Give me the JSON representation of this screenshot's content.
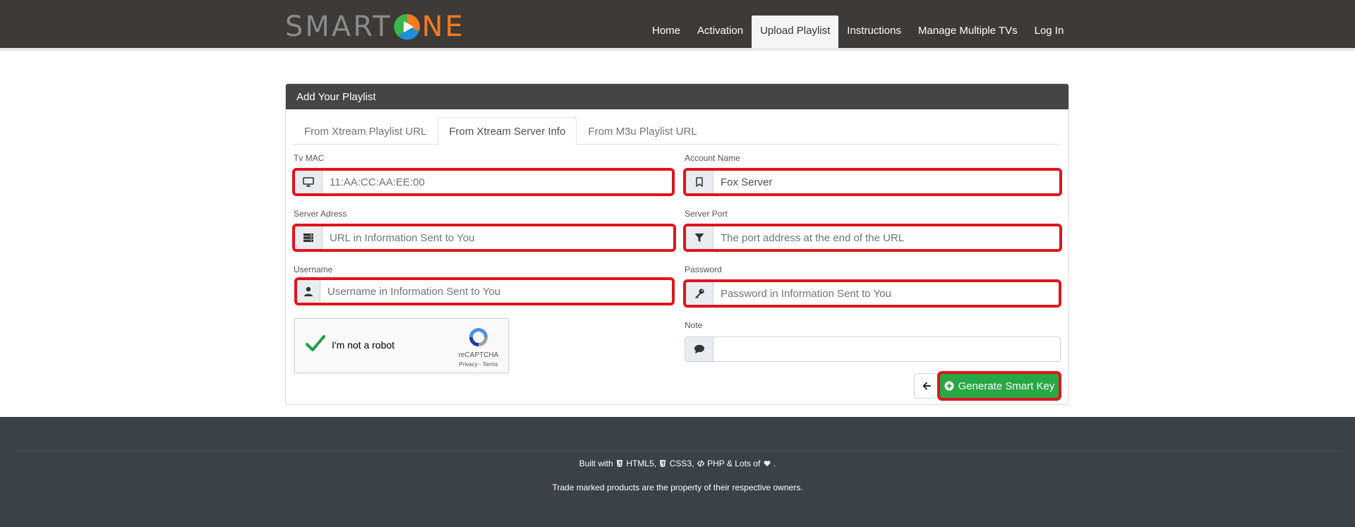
{
  "brand": {
    "part1": "SMART",
    "part2": "NE"
  },
  "nav": {
    "items": [
      {
        "label": "Home"
      },
      {
        "label": "Activation"
      },
      {
        "label": "Upload Playlist"
      },
      {
        "label": "Instructions"
      },
      {
        "label": "Manage Multiple TVs"
      },
      {
        "label": "Log In"
      }
    ],
    "active_index": 2
  },
  "card": {
    "title": "Add Your Playlist",
    "tabs": [
      {
        "label": "From Xtream Playlist URL"
      },
      {
        "label": "From Xtream Server Info"
      },
      {
        "label": "From M3u Playlist URL"
      }
    ],
    "active_tab": 1
  },
  "form": {
    "tv_mac": {
      "label": "Tv MAC",
      "value": "",
      "placeholder": "11:AA:CC:AA:EE:00",
      "icon": "tv-icon"
    },
    "account_name": {
      "label": "Account Name",
      "value": "Fox Server",
      "placeholder": "",
      "icon": "bookmark-icon"
    },
    "server_address": {
      "label": "Server Adress",
      "value": "",
      "placeholder": "URL in Information Sent to You",
      "icon": "server-icon"
    },
    "server_port": {
      "label": "Server Port",
      "value": "",
      "placeholder": "The port address at the end of the URL",
      "icon": "filter-icon"
    },
    "username": {
      "label": "Username",
      "value": "",
      "placeholder": "Username in Information Sent to You",
      "icon": "user-icon"
    },
    "password": {
      "label": "Password",
      "value": "",
      "placeholder": "Password in Information Sent to You",
      "icon": "key-icon"
    },
    "note": {
      "label": "Note",
      "value": "",
      "placeholder": "",
      "icon": "comment-icon"
    }
  },
  "recaptcha": {
    "label": "I'm not a robot",
    "brand": "reCAPTCHA",
    "links": "Privacy - Terms",
    "checked": true
  },
  "actions": {
    "back_icon": "arrow-left-icon",
    "generate_label": "Generate Smart Key",
    "generate_icon": "plus-circle-icon"
  },
  "footer": {
    "built_with": "Built with",
    "html5": "HTML5,",
    "css3": "CSS3,",
    "php": "PHP & Lots of",
    "end": ".",
    "trademark": "Trade marked products are the property of their respective owners."
  },
  "colors": {
    "header_bg": "#3d3a38",
    "brand_orange": "#f47b20",
    "highlight_red": "#e0141e",
    "button_green": "#28a745",
    "footer_bg": "#3a4147"
  }
}
